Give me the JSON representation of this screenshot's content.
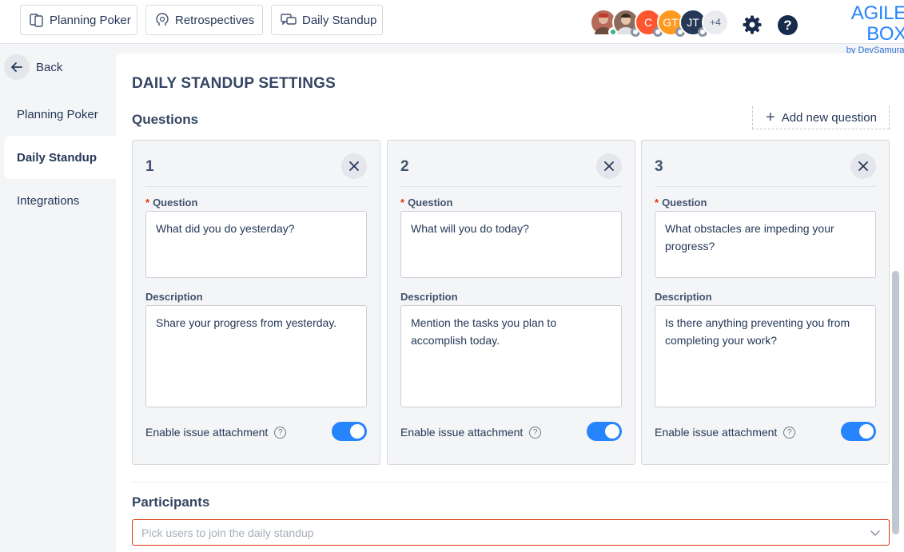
{
  "topbar": {
    "tabs": [
      {
        "label": "Planning Poker",
        "icon": "cards-icon"
      },
      {
        "label": "Retrospectives",
        "icon": "lightbulb-head-icon"
      },
      {
        "label": "Daily Standup",
        "icon": "chat-bubbles-icon"
      }
    ],
    "avatars": [
      {
        "initials": "",
        "color": "#b56a5a",
        "status": "online"
      },
      {
        "initials": "",
        "color": "#8b6b5c",
        "status": "offline"
      },
      {
        "initials": "C",
        "color": "#ff5630",
        "status": "offline"
      },
      {
        "initials": "GT",
        "color": "#ff991f",
        "status": "offline"
      },
      {
        "initials": "JT",
        "color": "#253858",
        "status": "offline"
      }
    ],
    "more_count": "+4",
    "help_glyph": "?",
    "brand": {
      "title": "AGILE BOX",
      "subtitle": "by DevSamurai"
    }
  },
  "sidebar": {
    "back_label": "Back",
    "items": [
      {
        "label": "Planning Poker",
        "active": false
      },
      {
        "label": "Daily Standup",
        "active": true
      },
      {
        "label": "Integrations",
        "active": false
      }
    ]
  },
  "main": {
    "title": "DAILY STANDUP SETTINGS",
    "questions_label": "Questions",
    "add_question_label": "Add new question",
    "question_label": "Question",
    "description_label": "Description",
    "attachment_label": "Enable issue attachment",
    "questions": [
      {
        "number": "1",
        "question": "What did you do yesterday?",
        "description": "Share your progress from yesterday.",
        "attachment_enabled": true
      },
      {
        "number": "2",
        "question": "What will you do today?",
        "description": "Mention the tasks you plan to accomplish today.",
        "attachment_enabled": true
      },
      {
        "number": "3",
        "question": "What obstacles are impeding your progress?",
        "description": "Is there anything preventing you from completing your work?",
        "attachment_enabled": true
      }
    ],
    "participants_label": "Participants",
    "participants_placeholder": "Pick users to join the daily standup"
  },
  "colors": {
    "accent": "#2684ff",
    "error": "#de350b",
    "text": "#253858"
  }
}
